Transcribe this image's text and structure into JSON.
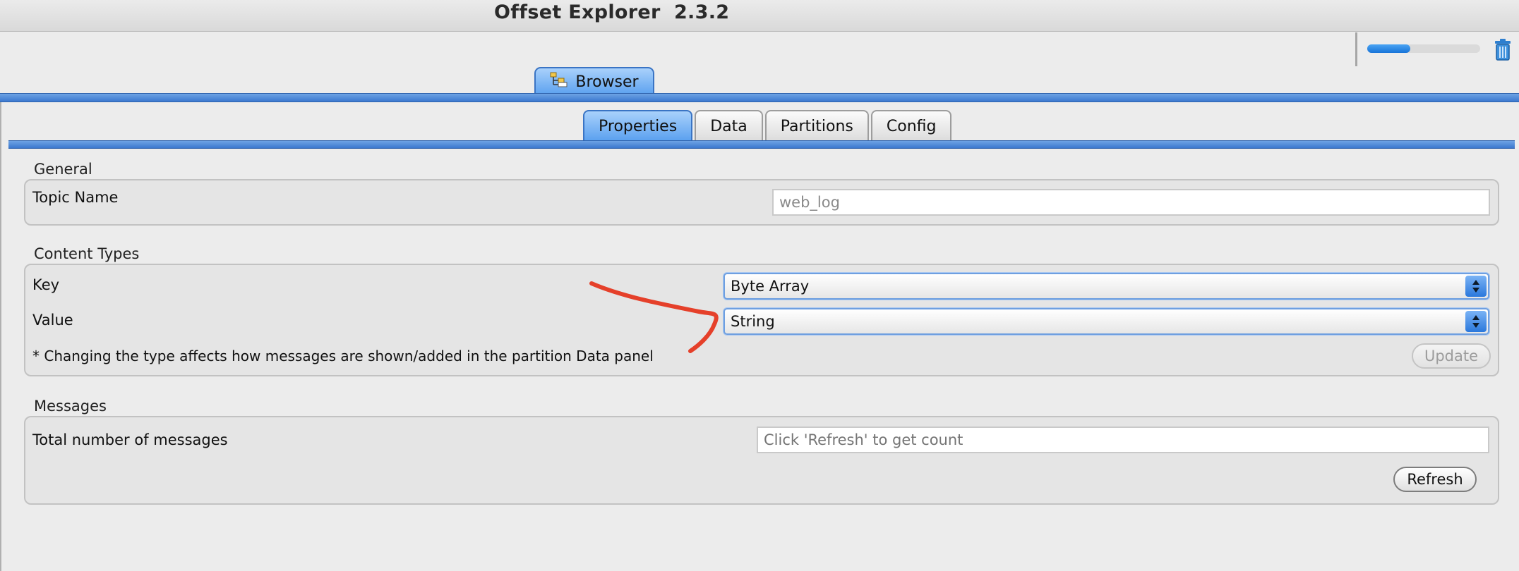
{
  "window": {
    "title": "Offset Explorer  2.3.2"
  },
  "toolbar": {
    "progress_fraction": 0.38,
    "trash_icon": "trash-icon"
  },
  "main_tab": {
    "label": "Browser",
    "icon": "tree-icon"
  },
  "subtabs": [
    {
      "label": "Properties",
      "active": true
    },
    {
      "label": "Data",
      "active": false
    },
    {
      "label": "Partitions",
      "active": false
    },
    {
      "label": "Config",
      "active": false
    }
  ],
  "general": {
    "title": "General",
    "topic_name_label": "Topic Name",
    "topic_name_value": "web_log"
  },
  "content_types": {
    "title": "Content Types",
    "key_label": "Key",
    "key_value": "Byte Array",
    "value_label": "Value",
    "value_value": "String",
    "note": "* Changing the type affects how messages are shown/added in the partition Data panel",
    "update_button": "Update"
  },
  "messages": {
    "title": "Messages",
    "total_label": "Total number of messages",
    "total_placeholder": "Click 'Refresh' to get count",
    "refresh_button": "Refresh"
  },
  "colors": {
    "accent_blue": "#5aa0ef",
    "annotation_red": "#e5402a"
  }
}
